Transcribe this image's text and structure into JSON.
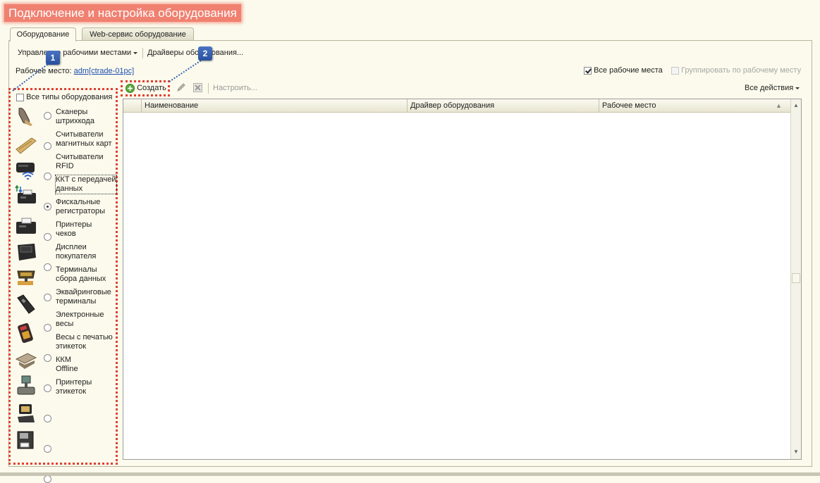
{
  "title": "Подключение и настройка оборудования",
  "tabs": [
    {
      "label": "Оборудование",
      "active": true
    },
    {
      "label": "Web-сервис оборудование",
      "active": false
    }
  ],
  "toolbar": {
    "manage_workplaces": "Управление рабочими местами",
    "drivers": "Драйверы оборудования..."
  },
  "workplace": {
    "label": "Рабочее место:",
    "value": "adm[ctrade-01pc]"
  },
  "options": {
    "all_workplaces": "Все рабочие места",
    "all_workplaces_checked": true,
    "group_by_workplace": "Группировать по рабочему месту",
    "group_by_workplace_enabled": false
  },
  "actions": {
    "create": "Создать",
    "configure": "Настроить...",
    "all_actions": "Все действия"
  },
  "equipment": {
    "all_types": "Все типы оборудования",
    "items": [
      {
        "line1": "Сканеры",
        "line2": "штрихкода",
        "icon": "barcode-scanner-icon",
        "selected": false
      },
      {
        "line1": "Считыватели",
        "line2": "магнитных карт",
        "icon": "magnetic-card-reader-icon",
        "selected": false
      },
      {
        "line1": "Считыватели",
        "line2": "RFID",
        "icon": "rfid-reader-icon",
        "selected": false
      },
      {
        "line1": "ККТ с передачей",
        "line2": "данных",
        "icon": "kkt-data-icon",
        "selected": true
      },
      {
        "line1": "Фискальные",
        "line2": "регистраторы",
        "icon": "fiscal-registrar-icon",
        "selected": false
      },
      {
        "line1": "Принтеры",
        "line2": "чеков",
        "icon": "receipt-printer-icon",
        "selected": false
      },
      {
        "line1": "Дисплеи",
        "line2": "покупателя",
        "icon": "customer-display-icon",
        "selected": false
      },
      {
        "line1": "Терминалы",
        "line2": "сбора данных",
        "icon": "data-terminal-icon",
        "selected": false
      },
      {
        "line1": "Эквайринговые",
        "line2": "терминалы",
        "icon": "acquiring-terminal-icon",
        "selected": false
      },
      {
        "line1": "Электронные",
        "line2": "весы",
        "icon": "electronic-scales-icon",
        "selected": false
      },
      {
        "line1": "Весы с печатью",
        "line2": "этикеток",
        "icon": "label-scales-icon",
        "selected": false
      },
      {
        "line1": "ККМ",
        "line2": "Offline",
        "icon": "kkm-offline-icon",
        "selected": false
      },
      {
        "line1": "Принтеры",
        "line2": "этикеток",
        "icon": "label-printer-icon",
        "selected": false
      }
    ],
    "extra_icons": [
      "pos-terminal-icon",
      "industrial-printer-icon"
    ]
  },
  "table": {
    "columns": [
      "Наименование",
      "Драйвер оборудования",
      "Рабочее место"
    ]
  },
  "callouts": [
    "1",
    "2"
  ],
  "colors": {
    "title_bg": "#f08070",
    "highlight": "#e04030",
    "callout": "#3a64b4",
    "background": "#fbfaec"
  }
}
